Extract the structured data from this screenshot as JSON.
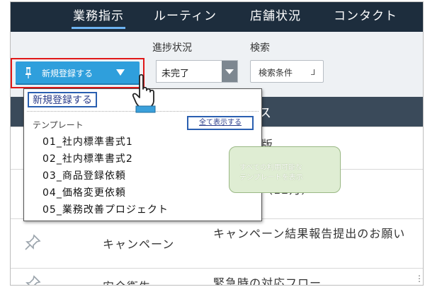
{
  "nav": {
    "items": [
      {
        "label": "業務指示",
        "active": true
      },
      {
        "label": "ルーティン",
        "active": false
      },
      {
        "label": "店舗状況",
        "active": false
      },
      {
        "label": "コンタクト",
        "active": false
      }
    ]
  },
  "toolbar": {
    "new_button_label": "新規登録する",
    "progress_label": "進捗状況",
    "progress_value": "未完了",
    "search_label": "検索",
    "search_button_label": "検索条件"
  },
  "dropdown": {
    "header": "新規登録する",
    "section_label": "テンプレート",
    "show_all_label": "全て表示する",
    "items": [
      "01_社内標準書式1",
      "02_社内標準書式2",
      "03_商品登録依頼",
      "04_価格変更依頼",
      "05_業務改善プロジェクト"
    ]
  },
  "tooltip": {
    "line1": "すべての利用可能な",
    "line2": "テンプレートを表示"
  },
  "list": {
    "head_text": "ス",
    "rows": [
      {
        "category": "",
        "title": "アル最新版"
      },
      {
        "category": "",
        "title": "イラート（12月）"
      },
      {
        "category": "キャンペーン",
        "title": "キャンペーン結果報告提出のお願い"
      },
      {
        "category": "安全衛生",
        "title": "緊急時の対応フロー"
      }
    ]
  },
  "colors": {
    "nav_bg": "#1d2d3d",
    "accent_button": "#2f9fdc",
    "highlight_outline": "#e01818",
    "tooltip_bg": "#dfedd3"
  }
}
